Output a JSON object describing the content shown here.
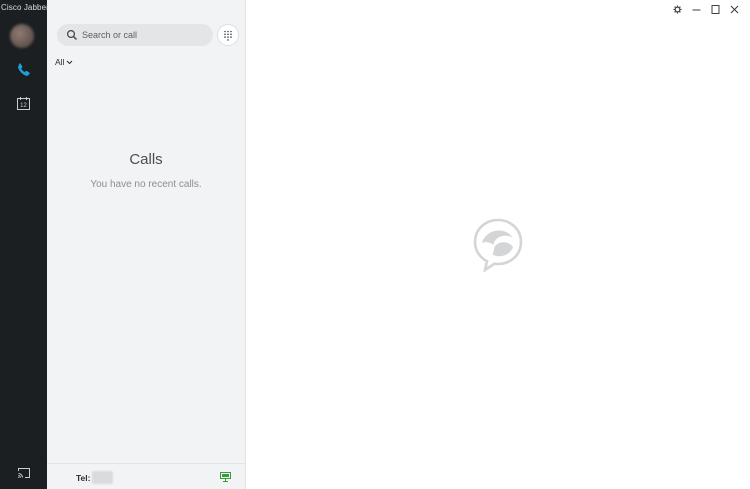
{
  "app": {
    "title": "Cisco Jabber"
  },
  "rail": {
    "items": [
      {
        "name": "calls",
        "icon": "phone-icon",
        "active": true
      },
      {
        "name": "meetings",
        "icon": "calendar-icon",
        "calendar_day": "12"
      }
    ],
    "bottom_icon": "cast-screen-icon"
  },
  "search": {
    "placeholder": "Search or call",
    "value": ""
  },
  "filter": {
    "label": "All"
  },
  "calls": {
    "title": "Calls",
    "empty_message": "You have no recent calls."
  },
  "footer": {
    "tel_label": "Tel:"
  },
  "colors": {
    "rail_bg": "#1b1f22",
    "accent": "#1ba0d7",
    "panel_bg": "#f2f3f4",
    "device_ok": "#3a9b3a"
  }
}
